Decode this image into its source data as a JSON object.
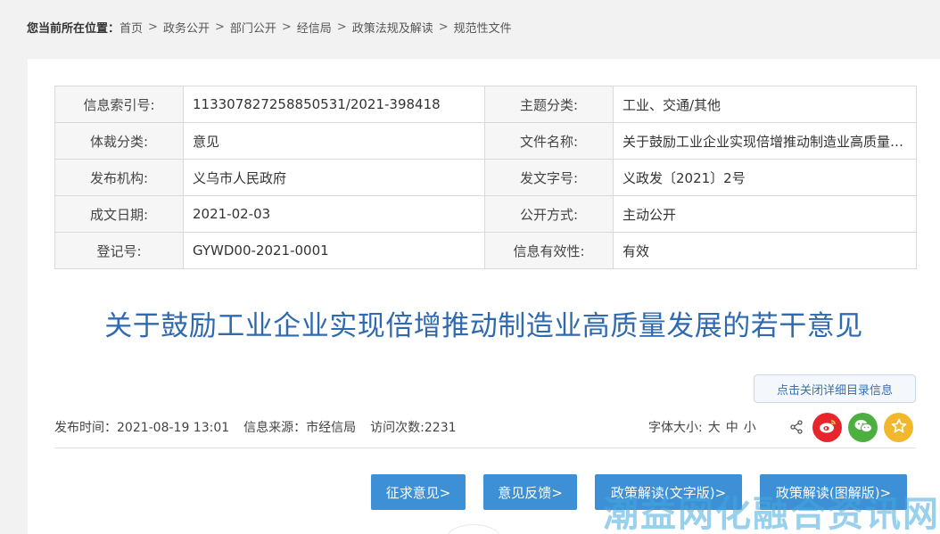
{
  "breadcrumb": {
    "label": "您当前所在位置：",
    "items": [
      "首页",
      "政务公开",
      "部门公开",
      "经信局",
      "政策法规及解读",
      "规范性文件"
    ],
    "separator": ">"
  },
  "meta_table": {
    "rows": [
      {
        "k1": "信息索引号:",
        "v1": "113307827258850531/2021-398418",
        "k2": "主题分类:",
        "v2": "工业、交通/其他"
      },
      {
        "k1": "体裁分类:",
        "v1": "意见",
        "k2": "文件名称:",
        "v2": "关于鼓励工业企业实现倍增推动制造业高质量发展的若干意见"
      },
      {
        "k1": "发布机构:",
        "v1": "义乌市人民政府",
        "k2": "发文字号:",
        "v2": "义政发〔2021〕2号"
      },
      {
        "k1": "成文日期:",
        "v1": "2021-02-03",
        "k2": "公开方式:",
        "v2": "主动公开"
      },
      {
        "k1": "登记号:",
        "v1": "GYWD00-2021-0001",
        "k2": "信息有效性:",
        "v2": "有效"
      }
    ]
  },
  "document": {
    "title": "关于鼓励工业企业实现倍增推动制造业高质量发展的若干意见"
  },
  "toggle_button": "点击关闭详细目录信息",
  "info": {
    "publish_time": "发布时间：2021-08-19 13:01",
    "source": "信息来源：市经信局",
    "visits": "访问次数:2231"
  },
  "font_size": {
    "label": "字体大小:",
    "large": "大",
    "medium": "中",
    "small": "小"
  },
  "share": {
    "icons": [
      "share-icon",
      "weibo-icon",
      "wechat-icon",
      "star-icon"
    ],
    "colors": {
      "weibo": "#e6252d",
      "wechat": "#4caf3f",
      "favorite": "#f1b82d"
    }
  },
  "actions": [
    "征求意见>",
    "意见反馈>",
    "政策解读(文字版)>",
    "政策解读(图解版)>"
  ],
  "watermark": "潮益网化融合资讯网",
  "colors": {
    "accent": "#3d8fd6",
    "title": "#2f6ab0"
  }
}
